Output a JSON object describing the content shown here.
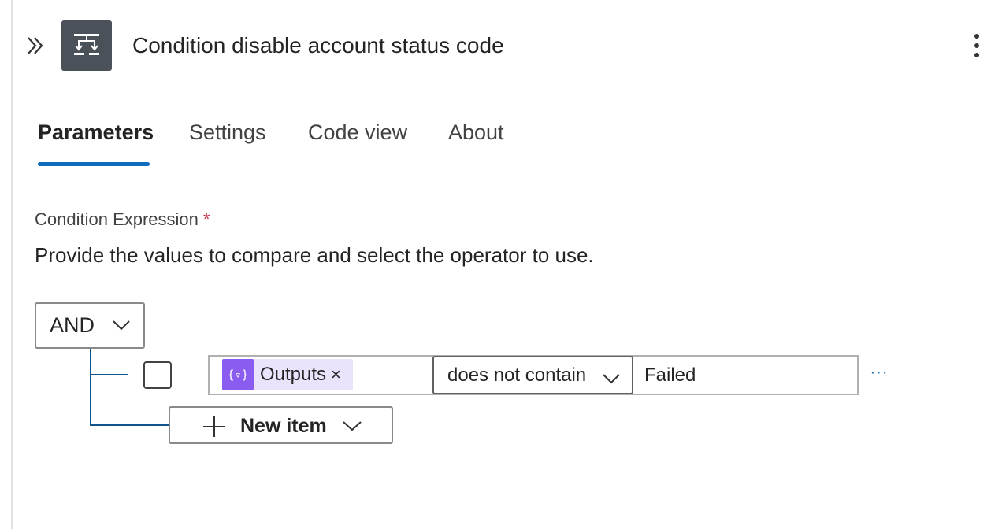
{
  "header": {
    "title": "Condition disable account status code",
    "collapse_icon": "chevron-double-right-icon",
    "action_icon": "condition-icon",
    "more_icon": "more-vertical-icon"
  },
  "tabs": [
    {
      "label": "Parameters",
      "active": true
    },
    {
      "label": "Settings",
      "active": false
    },
    {
      "label": "Code view",
      "active": false
    },
    {
      "label": "About",
      "active": false
    }
  ],
  "condition": {
    "label": "Condition Expression",
    "required_mark": "*",
    "description": "Provide the values to compare and select the operator to use.",
    "group_operator": "AND",
    "rows": [
      {
        "token": {
          "icon_text": "{▿}",
          "label": "Outputs",
          "remove": "×"
        },
        "operator": "does not contain",
        "value": "Failed",
        "more": "···"
      }
    ],
    "new_item_label": "New item"
  },
  "colors": {
    "accent": "#0f6cbd",
    "token_bg": "#ebe3fc",
    "token_icon_bg": "#8a5cf0",
    "required": "#c4314b",
    "icon_tile": "#4a5158"
  }
}
